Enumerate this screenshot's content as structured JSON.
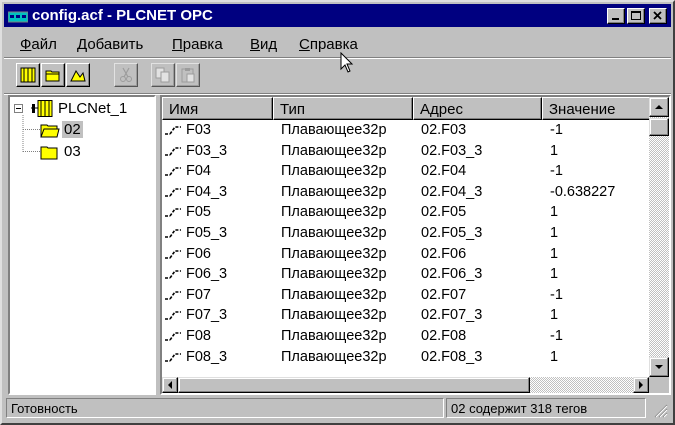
{
  "window": {
    "title": "config.acf - PLCNET OPC"
  },
  "menu": [
    {
      "acc": "Ф",
      "rest": "айл"
    },
    {
      "acc": "Д",
      "rest": "обавить"
    },
    {
      "acc": "П",
      "rest": "равка"
    },
    {
      "acc": "В",
      "rest": "ид"
    },
    {
      "acc": "С",
      "rest": "правка"
    }
  ],
  "toolbar": {
    "buttons": [
      "new-server-icon",
      "open-folder-icon",
      "new-tag-icon",
      "cut-icon",
      "copy-icon",
      "paste-icon"
    ]
  },
  "tree": {
    "root": "PLCNet_1",
    "children": [
      "02",
      "03"
    ],
    "selected": "02"
  },
  "list": {
    "columns": [
      "Имя",
      "Тип",
      "Адрес",
      "Значение"
    ],
    "rows": [
      {
        "name": "F03",
        "type": "Плавающее32р",
        "address": "02.F03",
        "value": "-1"
      },
      {
        "name": "F03_3",
        "type": "Плавающее32р",
        "address": "02.F03_3",
        "value": "1"
      },
      {
        "name": "F04",
        "type": "Плавающее32р",
        "address": "02.F04",
        "value": "-1"
      },
      {
        "name": "F04_3",
        "type": "Плавающее32р",
        "address": "02.F04_3",
        "value": "-0.638227"
      },
      {
        "name": "F05",
        "type": "Плавающее32р",
        "address": "02.F05",
        "value": "1"
      },
      {
        "name": "F05_3",
        "type": "Плавающее32р",
        "address": "02.F05_3",
        "value": "1"
      },
      {
        "name": "F06",
        "type": "Плавающее32р",
        "address": "02.F06",
        "value": "1"
      },
      {
        "name": "F06_3",
        "type": "Плавающее32р",
        "address": "02.F06_3",
        "value": "1"
      },
      {
        "name": "F07",
        "type": "Плавающее32р",
        "address": "02.F07",
        "value": "-1"
      },
      {
        "name": "F07_3",
        "type": "Плавающее32р",
        "address": "02.F07_3",
        "value": "1"
      },
      {
        "name": "F08",
        "type": "Плавающее32р",
        "address": "02.F08",
        "value": "-1"
      },
      {
        "name": "F08_3",
        "type": "Плавающее32р",
        "address": "02.F08_3",
        "value": "1"
      }
    ]
  },
  "status": {
    "left": "Готовность",
    "right": "02 содержит 318 тегов"
  },
  "colors": {
    "titlebar": "#000080",
    "face": "#c0c0c0",
    "folder": "#ffff00"
  }
}
